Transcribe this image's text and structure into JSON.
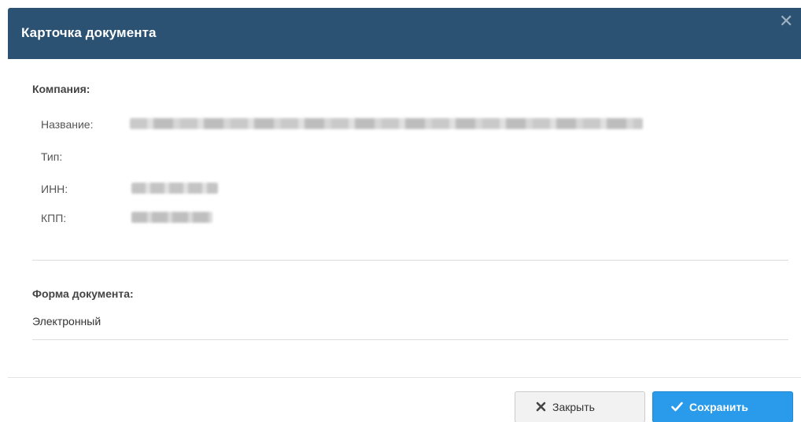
{
  "dialog": {
    "title": "Карточка документа",
    "close_icon": "close-icon"
  },
  "company": {
    "section_title": "Компания:",
    "name_label": "Название:",
    "type_label": "Тип:",
    "inn_label": "ИНН:",
    "kpp_label": "КПП:"
  },
  "document_form": {
    "section_title": "Форма документа:",
    "value": "Электронный"
  },
  "footer": {
    "close_label": "Закрыть",
    "close_icon": "x-icon",
    "save_label": "Сохранить",
    "save_icon": "checkmark-icon"
  },
  "colors": {
    "header_bg": "#2c5273",
    "primary_button": "#2a9bea"
  }
}
